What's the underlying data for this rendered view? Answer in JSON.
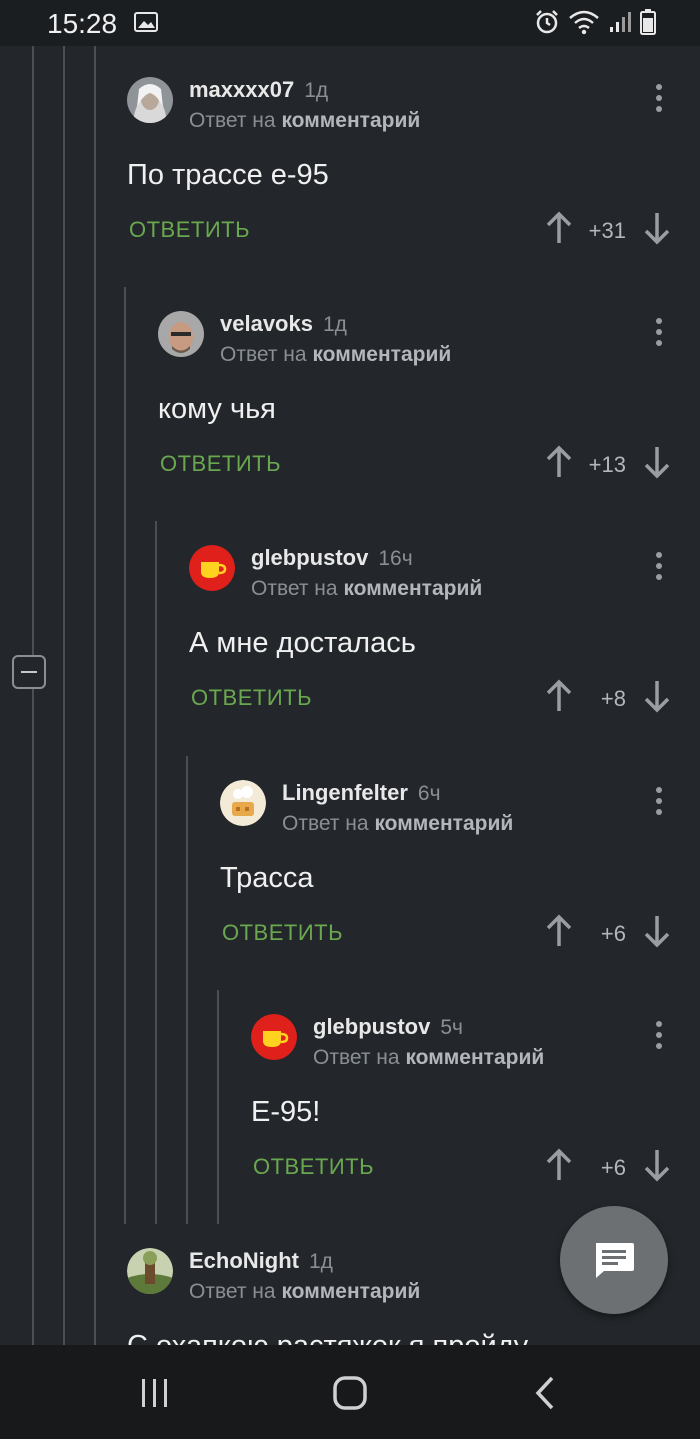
{
  "status_bar": {
    "time": "15:28"
  },
  "reply_to_text": "Ответ на",
  "reply_to_target": "комментарий",
  "reply_button_label": "ОТВЕТИТЬ",
  "comments": [
    {
      "username": "maxxxx07",
      "time": "1д",
      "text": "По трассе е-95",
      "score": "+31"
    },
    {
      "username": "velavoks",
      "time": "1д",
      "text": "кому чья",
      "score": "+13"
    },
    {
      "username": "glebpustov",
      "time": "16ч",
      "text": "А мне досталась",
      "score": "+8"
    },
    {
      "username": "Lingenfelter",
      "time": "6ч",
      "text": "Трасса",
      "score": "+6"
    },
    {
      "username": "glebpustov",
      "time": "5ч",
      "text": "Е-95!",
      "score": "+6"
    },
    {
      "username": "EchoNight",
      "time": "1д",
      "text": "С охапкою растяжек я пройду"
    }
  ],
  "colors": {
    "background": "#23272b",
    "reply_green": "#6aa84f",
    "muted": "#8a8f94",
    "avatar_red": "#e0201b"
  }
}
